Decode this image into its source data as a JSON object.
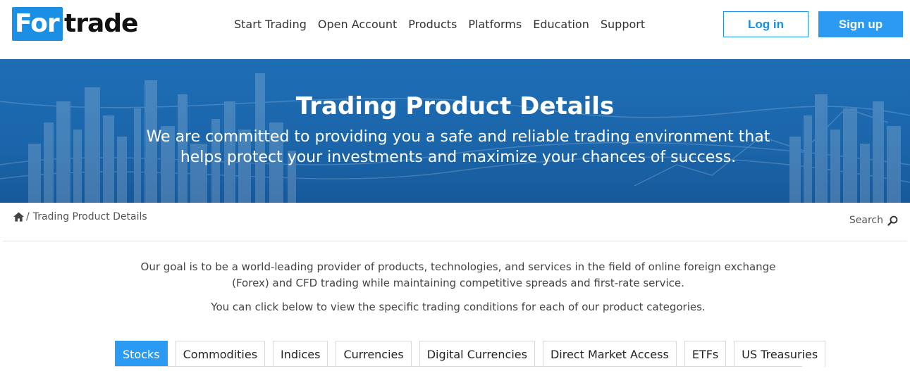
{
  "brand": {
    "logo_part1": "For",
    "logo_part2": "trade"
  },
  "nav": {
    "items": [
      "Start Trading",
      "Open Account",
      "Products",
      "Platforms",
      "Education",
      "Support"
    ]
  },
  "auth": {
    "login_label": "Log in",
    "signup_label": "Sign up"
  },
  "hero": {
    "title": "Trading Product Details",
    "subtitle": "We are committed to providing you a safe and reliable trading environment that helps protect your investments and maximize your chances of success."
  },
  "breadcrumb": {
    "separator": "/",
    "current": "Trading Product Details"
  },
  "search": {
    "label": "Search"
  },
  "intro": {
    "paragraph1": "Our goal is to be a world-leading provider of products, technologies, and services in the field of online foreign exchange (Forex) and CFD trading while maintaining competitive spreads and first-rate service.",
    "paragraph2": "You can click below to view the specific trading conditions for each of our product categories."
  },
  "tabs": {
    "items": [
      "Stocks",
      "Commodities",
      "Indices",
      "Currencies",
      "Digital Currencies",
      "Direct Market Access",
      "ETFs",
      "US Treasuries"
    ],
    "active": "Stocks"
  },
  "colors": {
    "accent": "#2b9af3",
    "hero_bg": "#1b65aa",
    "logo_blue": "#1a8fe3"
  },
  "icons": {
    "home": "home-icon",
    "search": "search-icon"
  }
}
